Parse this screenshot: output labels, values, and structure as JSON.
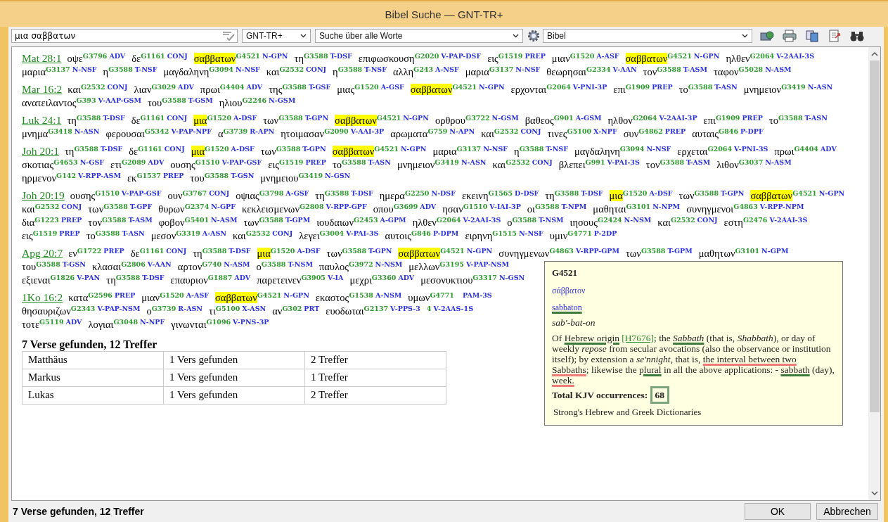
{
  "window": {
    "title": "Bibel Suche — GNT-TR+"
  },
  "toolbar": {
    "search": {
      "value": "μια σαββατων"
    },
    "version_dropdown": {
      "value": "GNT-TR+"
    },
    "mode_dropdown": {
      "value": "Suche über alle Worte"
    },
    "scope_dropdown": {
      "value": "Bibel"
    }
  },
  "verses": [
    {
      "ref": "Mat 28:1",
      "words": [
        {
          "word": "οψε",
          "strong": "G3796",
          "morph": "ADV",
          "hit": false
        },
        {
          "word": "δε",
          "strong": "G1161",
          "morph": "CONJ",
          "hit": false
        },
        {
          "word": "σαββατων",
          "strong": "G4521",
          "morph": "N-GPN",
          "hit": true
        },
        {
          "word": "τη",
          "strong": "G3588",
          "morph": "T-DSF",
          "hit": false
        },
        {
          "word": "επιφωσκουση",
          "strong": "G2020",
          "morph": "V-PAP-DSF",
          "hit": false
        },
        {
          "word": "εις",
          "strong": "G1519",
          "morph": "PREP",
          "hit": false
        },
        {
          "word": "μιαν",
          "strong": "G1520",
          "morph": "A-ASF",
          "hit": false
        },
        {
          "word": "σαββατων",
          "strong": "G4521",
          "morph": "N-GPN",
          "hit": true
        },
        {
          "word": "ηλθεν",
          "strong": "G2064",
          "morph": "V-2AAI-3S",
          "hit": false
        },
        {
          "word": "μαρια",
          "strong": "G3137",
          "morph": "N-NSF",
          "hit": false
        },
        {
          "word": "η",
          "strong": "G3588",
          "morph": "T-NSF",
          "hit": false
        },
        {
          "word": "μαγδαληνη",
          "strong": "G3094",
          "morph": "N-NSF",
          "hit": false
        },
        {
          "word": "και",
          "strong": "G2532",
          "morph": "CONJ",
          "hit": false
        },
        {
          "word": "η",
          "strong": "G3588",
          "morph": "T-NSF",
          "hit": false
        },
        {
          "word": "αλλη",
          "strong": "G243",
          "morph": "A-NSF",
          "hit": false
        },
        {
          "word": "μαρια",
          "strong": "G3137",
          "morph": "N-NSF",
          "hit": false
        },
        {
          "word": "θεωρησαι",
          "strong": "G2334",
          "morph": "V-AAN",
          "hit": false
        },
        {
          "word": "τον",
          "strong": "G3588",
          "morph": "T-ASM",
          "hit": false
        },
        {
          "word": "ταφον",
          "strong": "G5028",
          "morph": "N-ASM",
          "hit": false
        }
      ]
    },
    {
      "ref": "Mar 16:2",
      "words": [
        {
          "word": "και",
          "strong": "G2532",
          "morph": "CONJ",
          "hit": false
        },
        {
          "word": "λιαν",
          "strong": "G3029",
          "morph": "ADV",
          "hit": false
        },
        {
          "word": "πρωι",
          "strong": "G4404",
          "morph": "ADV",
          "hit": false
        },
        {
          "word": "της",
          "strong": "G3588",
          "morph": "T-GSF",
          "hit": false
        },
        {
          "word": "μιας",
          "strong": "G1520",
          "morph": "A-GSF",
          "hit": false
        },
        {
          "word": "σαββατων",
          "strong": "G4521",
          "morph": "N-GPN",
          "hit": true
        },
        {
          "word": "ερχονται",
          "strong": "G2064",
          "morph": "V-PNI-3P",
          "hit": false
        },
        {
          "word": "επι",
          "strong": "G1909",
          "morph": "PREP",
          "hit": false
        },
        {
          "word": "το",
          "strong": "G3588",
          "morph": "T-ASN",
          "hit": false
        },
        {
          "word": "μνημειον",
          "strong": "G3419",
          "morph": "N-ASN",
          "hit": false
        },
        {
          "word": "ανατειλαντος",
          "strong": "G393",
          "morph": "V-AAP-GSM",
          "hit": false
        },
        {
          "word": "του",
          "strong": "G3588",
          "morph": "T-GSM",
          "hit": false
        },
        {
          "word": "ηλιου",
          "strong": "G2246",
          "morph": "N-GSM",
          "hit": false
        }
      ]
    },
    {
      "ref": "Luk 24:1",
      "words": [
        {
          "word": "τη",
          "strong": "G3588",
          "morph": "T-DSF",
          "hit": false
        },
        {
          "word": "δε",
          "strong": "G1161",
          "morph": "CONJ",
          "hit": false
        },
        {
          "word": "μια",
          "strong": "G1520",
          "morph": "A-DSF",
          "hit": true
        },
        {
          "word": "των",
          "strong": "G3588",
          "morph": "T-GPN",
          "hit": false
        },
        {
          "word": "σαββατων",
          "strong": "G4521",
          "morph": "N-GPN",
          "hit": true
        },
        {
          "word": "ορθρου",
          "strong": "G3722",
          "morph": "N-GSM",
          "hit": false
        },
        {
          "word": "βαθεος",
          "strong": "G901",
          "morph": "A-GSM",
          "hit": false
        },
        {
          "word": "ηλθον",
          "strong": "G2064",
          "morph": "V-2AAI-3P",
          "hit": false
        },
        {
          "word": "επι",
          "strong": "G1909",
          "morph": "PREP",
          "hit": false
        },
        {
          "word": "το",
          "strong": "G3588",
          "morph": "T-ASN",
          "hit": false
        },
        {
          "word": "μνημα",
          "strong": "G3418",
          "morph": "N-ASN",
          "hit": false
        },
        {
          "word": "φερουσαι",
          "strong": "G5342",
          "morph": "V-PAP-NPF",
          "hit": false
        },
        {
          "word": "α",
          "strong": "G3739",
          "morph": "R-APN",
          "hit": false
        },
        {
          "word": "ητοιμασαν",
          "strong": "G2090",
          "morph": "V-AAI-3P",
          "hit": false
        },
        {
          "word": "αρωματα",
          "strong": "G759",
          "morph": "N-APN",
          "hit": false
        },
        {
          "word": "και",
          "strong": "G2532",
          "morph": "CONJ",
          "hit": false
        },
        {
          "word": "τινες",
          "strong": "G5100",
          "morph": "X-NPF",
          "hit": false
        },
        {
          "word": "συν",
          "strong": "G4862",
          "morph": "PREP",
          "hit": false
        },
        {
          "word": "αυταις",
          "strong": "G846",
          "morph": "P-DPF",
          "hit": false
        }
      ]
    },
    {
      "ref": "Joh 20:1",
      "words": [
        {
          "word": "τη",
          "strong": "G3588",
          "morph": "T-DSF",
          "hit": false
        },
        {
          "word": "δε",
          "strong": "G1161",
          "morph": "CONJ",
          "hit": false
        },
        {
          "word": "μια",
          "strong": "G1520",
          "morph": "A-DSF",
          "hit": true
        },
        {
          "word": "των",
          "strong": "G3588",
          "morph": "T-GPN",
          "hit": false
        },
        {
          "word": "σαββατων",
          "strong": "G4521",
          "morph": "N-GPN",
          "hit": true
        },
        {
          "word": "μαρια",
          "strong": "G3137",
          "morph": "N-NSF",
          "hit": false
        },
        {
          "word": "η",
          "strong": "G3588",
          "morph": "T-NSF",
          "hit": false
        },
        {
          "word": "μαγδαληνη",
          "strong": "G3094",
          "morph": "N-NSF",
          "hit": false
        },
        {
          "word": "ερχεται",
          "strong": "G2064",
          "morph": "V-PNI-3S",
          "hit": false
        },
        {
          "word": "πρωι",
          "strong": "G4404",
          "morph": "ADV",
          "hit": false
        },
        {
          "word": "σκοτιας",
          "strong": "G4653",
          "morph": "N-GSF",
          "hit": false
        },
        {
          "word": "ετι",
          "strong": "G2089",
          "morph": "ADV",
          "hit": false
        },
        {
          "word": "ουσης",
          "strong": "G1510",
          "morph": "V-PAP-GSF",
          "hit": false
        },
        {
          "word": "εις",
          "strong": "G1519",
          "morph": "PREP",
          "hit": false
        },
        {
          "word": "το",
          "strong": "G3588",
          "morph": "T-ASN",
          "hit": false
        },
        {
          "word": "μνημειον",
          "strong": "G3419",
          "morph": "N-ASN",
          "hit": false
        },
        {
          "word": "και",
          "strong": "G2532",
          "morph": "CONJ",
          "hit": false
        },
        {
          "word": "βλεπει",
          "strong": "G991",
          "morph": "V-PAI-3S",
          "hit": false
        },
        {
          "word": "τον",
          "strong": "G3588",
          "morph": "T-ASM",
          "hit": false
        },
        {
          "word": "λιθον",
          "strong": "G3037",
          "morph": "N-ASM",
          "hit": false
        },
        {
          "word": "ηρμενον",
          "strong": "G142",
          "morph": "V-RPP-ASM",
          "hit": false
        },
        {
          "word": "εκ",
          "strong": "G1537",
          "morph": "PREP",
          "hit": false
        },
        {
          "word": "του",
          "strong": "G3588",
          "morph": "T-GSN",
          "hit": false
        },
        {
          "word": "μνημειου",
          "strong": "G3419",
          "morph": "N-GSN",
          "hit": false
        }
      ]
    },
    {
      "ref": "Joh 20:19",
      "words": [
        {
          "word": "ουσης",
          "strong": "G1510",
          "morph": "V-PAP-GSF",
          "hit": false
        },
        {
          "word": "ουν",
          "strong": "G3767",
          "morph": "CONJ",
          "hit": false
        },
        {
          "word": "οψιας",
          "strong": "G3798",
          "morph": "A-GSF",
          "hit": false
        },
        {
          "word": "τη",
          "strong": "G3588",
          "morph": "T-DSF",
          "hit": false
        },
        {
          "word": "ημερα",
          "strong": "G2250",
          "morph": "N-DSF",
          "hit": false
        },
        {
          "word": "εκεινη",
          "strong": "G1565",
          "morph": "D-DSF",
          "hit": false
        },
        {
          "word": "τη",
          "strong": "G3588",
          "morph": "T-DSF",
          "hit": false
        },
        {
          "word": "μια",
          "strong": "G1520",
          "morph": "A-DSF",
          "hit": true
        },
        {
          "word": "των",
          "strong": "G3588",
          "morph": "T-GPN",
          "hit": false
        },
        {
          "word": "σαββατων",
          "strong": "G4521",
          "morph": "N-GPN",
          "hit": true
        },
        {
          "word": "και",
          "strong": "G2532",
          "morph": "CONJ",
          "hit": false
        },
        {
          "word": "των",
          "strong": "G3588",
          "morph": "T-GPF",
          "hit": false
        },
        {
          "word": "θυρων",
          "strong": "G2374",
          "morph": "N-GPF",
          "hit": false
        },
        {
          "word": "κεκλεισμενων",
          "strong": "G2808",
          "morph": "V-RPP-GPF",
          "hit": false
        },
        {
          "word": "οπου",
          "strong": "G3699",
          "morph": "ADV",
          "hit": false
        },
        {
          "word": "ησαν",
          "strong": "G1510",
          "morph": "V-IAI-3P",
          "hit": false
        },
        {
          "word": "οι",
          "strong": "G3588",
          "morph": "T-NPM",
          "hit": false
        },
        {
          "word": "μαθηται",
          "strong": "G3101",
          "morph": "N-NPM",
          "hit": false
        },
        {
          "word": "συνηγμενοι",
          "strong": "G4863",
          "morph": "V-RPP-NPM",
          "hit": false
        },
        {
          "word": "δια",
          "strong": "G1223",
          "morph": "PREP",
          "hit": false
        },
        {
          "word": "τον",
          "strong": "G3588",
          "morph": "T-ASM",
          "hit": false
        },
        {
          "word": "φοβον",
          "strong": "G5401",
          "morph": "N-ASM",
          "hit": false
        },
        {
          "word": "των",
          "strong": "G3588",
          "morph": "T-GPM",
          "hit": false
        },
        {
          "word": "ιουδαιων",
          "strong": "G2453",
          "morph": "A-GPM",
          "hit": false
        },
        {
          "word": "ηλθεν",
          "strong": "G2064",
          "morph": "V-2AAI-3S",
          "hit": false
        },
        {
          "word": "ο",
          "strong": "G3588",
          "morph": "T-NSM",
          "hit": false
        },
        {
          "word": "ιησους",
          "strong": "G2424",
          "morph": "N-NSM",
          "hit": false
        },
        {
          "word": "και",
          "strong": "G2532",
          "morph": "CONJ",
          "hit": false
        },
        {
          "word": "εστη",
          "strong": "G2476",
          "morph": "V-2AAI-3S",
          "hit": false
        },
        {
          "word": "εις",
          "strong": "G1519",
          "morph": "PREP",
          "hit": false
        },
        {
          "word": "το",
          "strong": "G3588",
          "morph": "T-ASN",
          "hit": false
        },
        {
          "word": "μεσον",
          "strong": "G3319",
          "morph": "A-ASN",
          "hit": false
        },
        {
          "word": "και",
          "strong": "G2532",
          "morph": "CONJ",
          "hit": false
        },
        {
          "word": "λεγει",
          "strong": "G3004",
          "morph": "V-PAI-3S",
          "hit": false
        },
        {
          "word": "αυτοις",
          "strong": "G846",
          "morph": "P-DPM",
          "hit": false
        },
        {
          "word": "ειρηνη",
          "strong": "G1515",
          "morph": "N-NSF",
          "hit": false
        },
        {
          "word": "υμιν",
          "strong": "G4771",
          "morph": "P-2DP",
          "hit": false
        }
      ]
    },
    {
      "ref": "Apg 20:7",
      "words": [
        {
          "word": "εν",
          "strong": "G1722",
          "morph": "PREP",
          "hit": false
        },
        {
          "word": "δε",
          "strong": "G1161",
          "morph": "CONJ",
          "hit": false
        },
        {
          "word": "τη",
          "strong": "G3588",
          "morph": "T-DSF",
          "hit": false
        },
        {
          "word": "μια",
          "strong": "G1520",
          "morph": "A-DSF",
          "hit": true
        },
        {
          "word": "των",
          "strong": "G3588",
          "morph": "T-GPN",
          "hit": false
        },
        {
          "word": "σαββατων",
          "strong": "G4521",
          "morph": "N-GPN",
          "hit": true
        },
        {
          "word": "συνηγμενων",
          "strong": "G4863",
          "morph": "V-RPP-GPM",
          "hit": false
        },
        {
          "word": "των",
          "strong": "G3588",
          "morph": "T-GPM",
          "hit": false
        },
        {
          "word": "μαθητων",
          "strong": "G3101",
          "morph": "N-GPM",
          "hit": false
        },
        {
          "word": "του",
          "strong": "G3588",
          "morph": "T-GSN",
          "hit": false
        },
        {
          "word": "κλασαι",
          "strong": "G2806",
          "morph": "V-AAN",
          "hit": false
        },
        {
          "word": "αρτον",
          "strong": "G740",
          "morph": "N-ASM",
          "hit": false
        },
        {
          "word": "ο",
          "strong": "G3588",
          "morph": "T-NSM",
          "hit": false
        },
        {
          "word": "παυλος",
          "strong": "G3972",
          "morph": "N-NSM",
          "hit": false
        },
        {
          "word": "μελλων",
          "strong": "G3195",
          "morph": "V-PAP-NSM",
          "hit": false
        },
        {
          "word": "εξιεναι",
          "strong": "G1826",
          "morph": "V-PAN",
          "hit": false
        },
        {
          "word": "τη",
          "strong": "G3588",
          "morph": "T-DSF",
          "hit": false
        },
        {
          "word": "επαυριον",
          "strong": "G1887",
          "morph": "ADV",
          "hit": false
        },
        {
          "word": "παρετεινεν",
          "strong": "G3905",
          "morph": "V-IA",
          "hit": false
        },
        {
          "word": "μεχρι",
          "strong": "G3360",
          "morph": "ADV",
          "hit": false
        },
        {
          "word": "μεσονυκτιου",
          "strong": "G3317",
          "morph": "N-GSN",
          "hit": false
        }
      ]
    },
    {
      "ref": "1Ko 16:2",
      "words": [
        {
          "word": "κατα",
          "strong": "G2596",
          "morph": "PREP",
          "hit": false
        },
        {
          "word": "μιαν",
          "strong": "G1520",
          "morph": "A-ASF",
          "hit": false
        },
        {
          "word": "σαββατων",
          "strong": "G4521",
          "morph": "N-GPN",
          "hit": true
        },
        {
          "word": "εκαστος",
          "strong": "G1538",
          "morph": "A-NSM",
          "hit": false
        },
        {
          "word": "υμων",
          "strong": "G4771",
          "hit": false
        },
        {
          "morph": "PAM-3S",
          "hit": false
        },
        {
          "word": "θησαυριζων",
          "strong": "G2343",
          "morph": "V-PAP-NSM",
          "hit": false
        },
        {
          "word": "ο",
          "strong": "G3739",
          "morph": "R-ASN",
          "hit": false
        },
        {
          "word": "τι",
          "strong": "G5100",
          "morph": "X-ASN",
          "hit": false
        },
        {
          "word": "αν",
          "strong": "G302",
          "morph": "PRT",
          "hit": false
        },
        {
          "word": "ευοδωται",
          "strong": "G2137",
          "morph": "V-PPS-3",
          "hit": false
        },
        {
          "strong": "4",
          "morph": "V-2AAS-1S",
          "hit": false
        },
        {
          "word": "τοτε",
          "strong": "G5119",
          "morph": "ADV",
          "hit": false
        },
        {
          "word": "λογιαι",
          "strong": "G3048",
          "morph": "N-NPF",
          "hit": false
        },
        {
          "word": "γινωνται",
          "strong": "G1096",
          "morph": "V-PNS-3P",
          "hit": false
        }
      ]
    }
  ],
  "tooltip": {
    "strong": "G4521",
    "greek": "σάββατον",
    "translit": {
      "text": "sabbaton",
      "color": "#3d7a3d"
    },
    "pronunciation": "sab'-bat-on",
    "definition": [
      {
        "kind": "text",
        "text": "Of "
      },
      {
        "kind": "text",
        "text": "Hebrew origin",
        "color": "#3d7a3d"
      },
      {
        "kind": "link",
        "text": "[H7676]"
      },
      {
        "kind": "text",
        "text": "; the "
      },
      {
        "kind": "text",
        "text": "*Sabbath*",
        "color": "#3d7a3d"
      },
      {
        "kind": "text",
        "text": " (that is, *Shabbath*), or day of weekly *repose* from secular avocations (also the observance or institution itself); by extension a *se'nnight*, that is, "
      },
      {
        "kind": "text",
        "text": "the interval between two Sabbaths",
        "color": "#f07a7a"
      },
      {
        "kind": "text",
        "text": "; likewise the "
      },
      {
        "kind": "text",
        "text": "plural",
        "color": "#3d7a3d"
      },
      {
        "kind": "text",
        "text": " in all the above applications: - "
      },
      {
        "kind": "text",
        "text": "sabbath",
        "color": "#3d7a3d"
      },
      {
        "kind": "text",
        "text": " (day), "
      },
      {
        "kind": "text",
        "text": "week.",
        "color": "#f07a7a"
      }
    ],
    "total_label": "Total KJV occurrences:",
    "total": {
      "value": "68",
      "boxed": true
    },
    "source": "Strong's Hebrew and Greek Dictionaries"
  },
  "results": {
    "heading": "7 Verse gefunden, 12 Treffer",
    "rows": [
      {
        "book": "Matthäus",
        "verses": "1 Vers gefunden",
        "hits": "2 Treffer"
      },
      {
        "book": "Markus",
        "verses": "1 Vers gefunden",
        "hits": "1 Treffer"
      },
      {
        "book": "Lukas",
        "verses": "1 Vers gefunden",
        "hits": "2 Treffer"
      }
    ]
  },
  "status_bar": {
    "text": "7 Verse gefunden, 12 Treffer"
  },
  "buttons": [
    "OK",
    "Abbrechen"
  ]
}
